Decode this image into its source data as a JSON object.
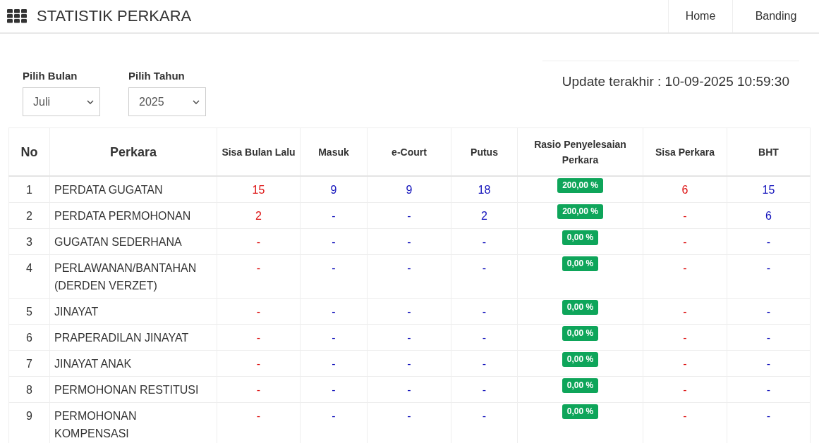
{
  "header": {
    "title": "STATISTIK PERKARA",
    "nav": [
      {
        "label": "Home"
      },
      {
        "label": "Banding"
      }
    ]
  },
  "filters": [
    {
      "label": "Pilih Bulan",
      "value": "Juli"
    },
    {
      "label": "Pilih Tahun",
      "value": "2025"
    }
  ],
  "update": "Update terakhir : 10-09-2025 10:59:30",
  "table": {
    "columns": [
      {
        "label": "No",
        "kind": "no"
      },
      {
        "label": "Perkara",
        "kind": "name"
      },
      {
        "label": "Sisa Bulan Lalu",
        "kind": "num",
        "color": "#dd1111"
      },
      {
        "label": "Masuk",
        "kind": "num",
        "color": "#1111bb"
      },
      {
        "label": "e-Court",
        "kind": "num",
        "color": "#1111bb"
      },
      {
        "label": "Putus",
        "kind": "num",
        "color": "#1111bb"
      },
      {
        "label": "Rasio Penyelesaian Perkara",
        "kind": "badge"
      },
      {
        "label": "Sisa Perkara",
        "kind": "num",
        "color": "#dd1111"
      },
      {
        "label": "BHT",
        "kind": "num",
        "color": "#1111bb"
      }
    ],
    "rows": [
      [
        "1",
        "PERDATA GUGATAN",
        "15",
        "9",
        "9",
        "18",
        "200,00 %",
        "6",
        "15"
      ],
      [
        "2",
        "PERDATA PERMOHONAN",
        "2",
        "-",
        "-",
        "2",
        "200,00 %",
        "-",
        "6"
      ],
      [
        "3",
        "GUGATAN SEDERHANA",
        "-",
        "-",
        "-",
        "-",
        "0,00 %",
        "-",
        "-"
      ],
      [
        "4",
        "PERLAWANAN/BANTAHAN (DERDEN VERZET)",
        "-",
        "-",
        "-",
        "-",
        "0,00 %",
        "-",
        "-"
      ],
      [
        "5",
        "JINAYAT",
        "-",
        "-",
        "-",
        "-",
        "0,00 %",
        "-",
        "-"
      ],
      [
        "6",
        "PRAPERADILAN JINAYAT",
        "-",
        "-",
        "-",
        "-",
        "0,00 %",
        "-",
        "-"
      ],
      [
        "7",
        "JINAYAT ANAK",
        "-",
        "-",
        "-",
        "-",
        "0,00 %",
        "-",
        "-"
      ],
      [
        "8",
        "PERMOHONAN RESTITUSI",
        "-",
        "-",
        "-",
        "-",
        "0,00 %",
        "-",
        "-"
      ],
      [
        "9",
        "PERMOHONAN KOMPENSASI",
        "-",
        "-",
        "-",
        "-",
        "0,00 %",
        "-",
        "-"
      ]
    ]
  }
}
